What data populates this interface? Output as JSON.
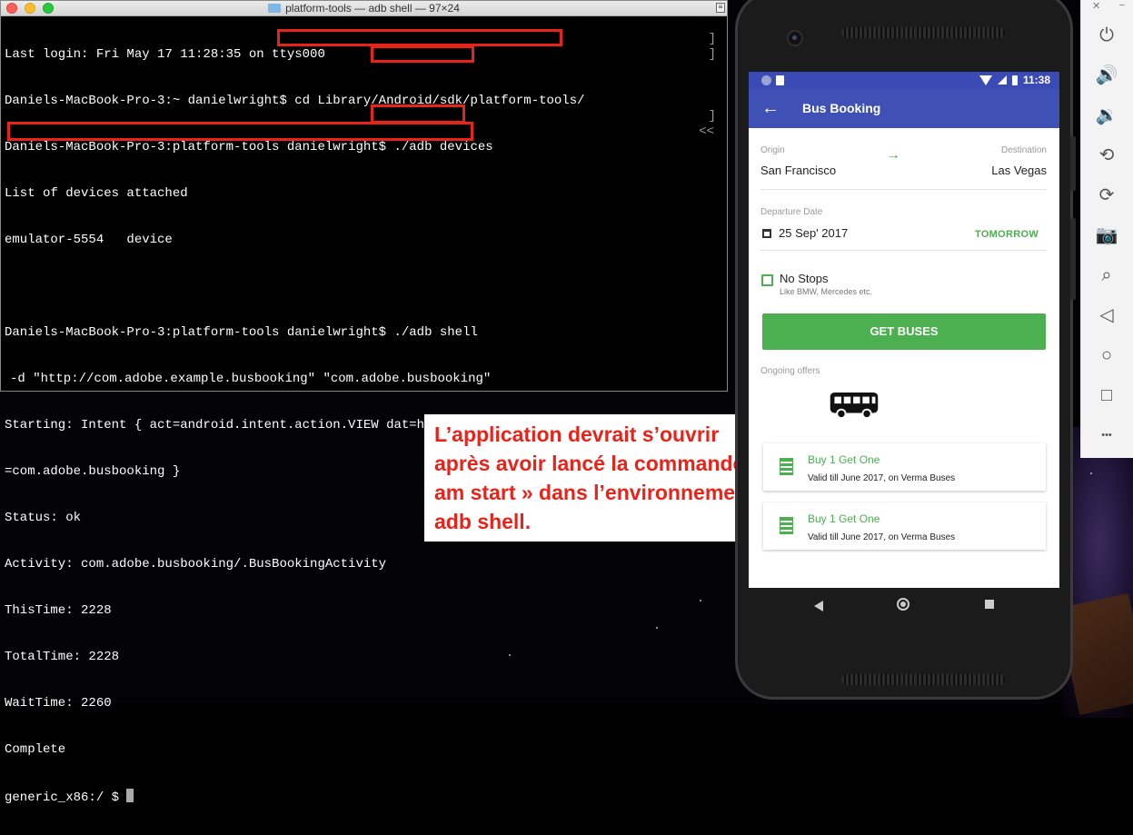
{
  "terminal": {
    "title": "platform-tools — adb shell — 97×24",
    "lines": [
      "Last login: Fri May 17 11:28:35 on ttys000",
      "Daniels-MacBook-Pro-3:~ danielwright$ cd Library/Android/sdk/platform-tools/",
      "Daniels-MacBook-Pro-3:platform-tools danielwright$ ./adb devices",
      "List of devices attached",
      "emulator-5554   device",
      "",
      "Daniels-MacBook-Pro-3:platform-tools danielwright$ ./adb shell",
      "-d \"http://com.adobe.example.busbooking\" \"com.adobe.busbooking\"",
      "Starting: Intent { act=android.intent.action.VIEW dat=http://com.adobe.example.busbooking/... pkg",
      "=com.adobe.busbooking }",
      "Status: ok",
      "Activity: com.adobe.busbooking/.BusBookingActivity",
      "ThisTime: 2228",
      "TotalTime: 2228",
      "WaitTime: 2260",
      "Complete",
      "generic_x86:/ $ "
    ],
    "overflow_marker": "<<"
  },
  "callout": {
    "text": "L’application devrait s’ouvrir après avoir lancé la commande « am start » dans l’environnement adb shell."
  },
  "phone": {
    "status_time": "11:38",
    "app_title": "Bus Booking",
    "origin_label": "Origin",
    "origin_value": "San Francisco",
    "destination_label": "Destination",
    "destination_value": "Las Vegas",
    "departure_label": "Departure Date",
    "departure_value": "25 Sep' 2017",
    "tomorrow_label": "TOMORROW",
    "no_stops_label": "No Stops",
    "no_stops_sub": "Like BMW, Mercedes etc.",
    "get_buses_label": "GET BUSES",
    "offers_label": "Ongoing offers",
    "offers": [
      {
        "title": "Buy 1 Get One",
        "valid": "Valid till June 2017, on ",
        "operator": "Verma Buses"
      },
      {
        "title": "Buy 1 Get One",
        "valid": "Valid till June 2017, on ",
        "operator": "Verma Buses"
      }
    ]
  },
  "toolbar": {
    "close": "✕",
    "minimize": "−",
    "more": "•••"
  },
  "colors": {
    "highlight": "#e8231a",
    "app_primary": "#3f51b5",
    "accent_green": "#4caf50"
  }
}
